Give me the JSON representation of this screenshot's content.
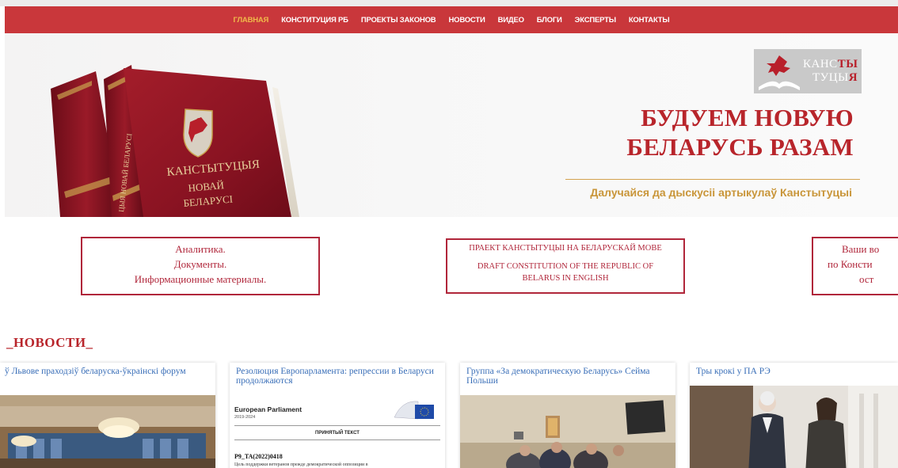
{
  "nav": {
    "items": [
      {
        "label": "ГЛАВНАЯ",
        "active": true
      },
      {
        "label": "КОНСТИТУЦИЯ РБ"
      },
      {
        "label": "ПРОЕКТЫ ЗАКОНОВ"
      },
      {
        "label": "НОВОСТИ"
      },
      {
        "label": "ВИДЕО"
      },
      {
        "label": "БЛОГИ"
      },
      {
        "label": "ЭКСПЕРТЫ"
      },
      {
        "label": "КОНТАКТЫ"
      }
    ]
  },
  "hero": {
    "book_text_1": "КАНСТЫТУЦЫЯ",
    "book_text_2": "НОВАЙ",
    "book_text_3": "БЕЛАРУСІ",
    "spine_text": "ЦЫЯ НОВАЙ БЕЛАРУСІ",
    "logo_line1_a": "КАНС",
    "logo_line1_b": "ТЫ",
    "logo_line2_a": "ТУЦЫ",
    "logo_line2_b": "Я",
    "title_line1": "БУДУЕМ НОВУЮ",
    "title_line2": "БЕЛАРУСЬ РАЗАМ",
    "subtitle": "Далучайся да дыскусіі артыкулаў Канстытуцыі"
  },
  "buttons": {
    "analytics": {
      "line1": "Аналитика.",
      "line2": "Документы.",
      "line3": "Информационные материалы."
    },
    "draft": {
      "line1": "ПРАЕКТ КАНСТЫТУЦЫІ НА БЕЛАРУСКАЙ МОВЕ",
      "line2": "DRAFT CONSTITUTION OF THE REPUBLIC OF",
      "line3": "BELARUS IN ENGLISH"
    },
    "questions": {
      "line1": "Ваши во",
      "line2": "по Консти",
      "line3": "ост"
    }
  },
  "news": {
    "heading": "_НОВОСТИ_",
    "cards": [
      {
        "title": "ў Львове праходзіў беларуска-ўкраінскі форум"
      },
      {
        "title": "Резолюция Европарламента: репрессии в Беларуси продолжаются",
        "doc_org": "European Parliament",
        "doc_years": "2019-2024",
        "doc_label": "ПРИНЯТЫЙ ТЕКСТ",
        "doc_ref": "P9_TA(2022)0418",
        "doc_body": "Цель поддержки ветеранов прежде демократической оппозиции в"
      },
      {
        "title": "Группа «За демократическую Беларусь» Сейма Польши"
      },
      {
        "title": "Тры крокі у ПА РЭ"
      }
    ]
  },
  "colors": {
    "nav_bg": "#c9373b",
    "nav_active": "#f0b94a",
    "brand_red": "#b8252b",
    "gold": "#c9963a",
    "link_blue": "#3a6fb8"
  }
}
